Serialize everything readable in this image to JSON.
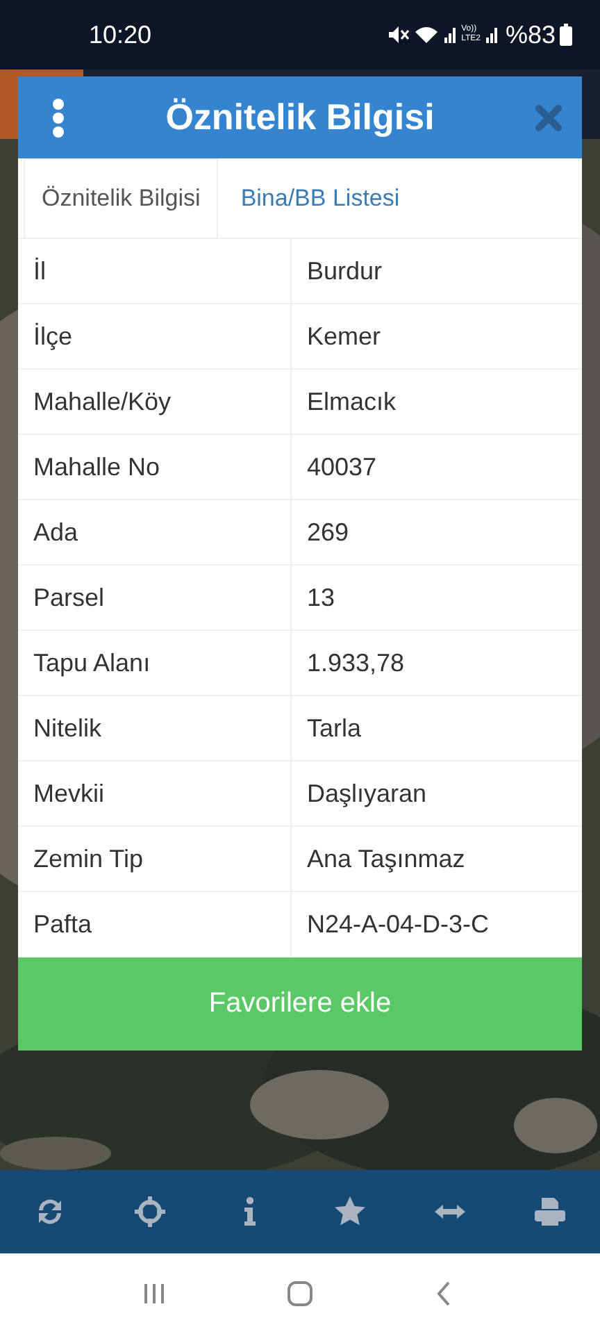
{
  "status_bar": {
    "time": "10:20",
    "volte": "Vo))",
    "network": "LTE2",
    "battery": "%83"
  },
  "dialog": {
    "title": "Öznitelik Bilgisi",
    "tabs": [
      {
        "label": "Öznitelik Bilgisi",
        "selected": true
      },
      {
        "label": "Bina/BB Listesi",
        "selected": false
      }
    ],
    "rows": [
      {
        "label": "İl",
        "value": "Burdur"
      },
      {
        "label": "İlçe",
        "value": "Kemer"
      },
      {
        "label": "Mahalle/Köy",
        "value": "Elmacık"
      },
      {
        "label": "Mahalle No",
        "value": "40037"
      },
      {
        "label": "Ada",
        "value": "269"
      },
      {
        "label": "Parsel",
        "value": "13"
      },
      {
        "label": "Tapu Alanı",
        "value": "1.933,78"
      },
      {
        "label": "Nitelik",
        "value": "Tarla"
      },
      {
        "label": "Mevkii",
        "value": "Daşlıyaran"
      },
      {
        "label": "Zemin Tip",
        "value": "Ana Taşınmaz"
      },
      {
        "label": "Pafta",
        "value": "N24-A-04-D-3-C"
      }
    ],
    "button": "Favorilere ekle"
  },
  "toolbar": [
    {
      "kind": "refresh"
    },
    {
      "kind": "locate"
    },
    {
      "kind": "info"
    },
    {
      "kind": "star"
    },
    {
      "kind": "measure"
    },
    {
      "kind": "print"
    }
  ],
  "nav_bar": [
    {
      "kind": "recents"
    },
    {
      "kind": "home"
    },
    {
      "kind": "back"
    }
  ]
}
